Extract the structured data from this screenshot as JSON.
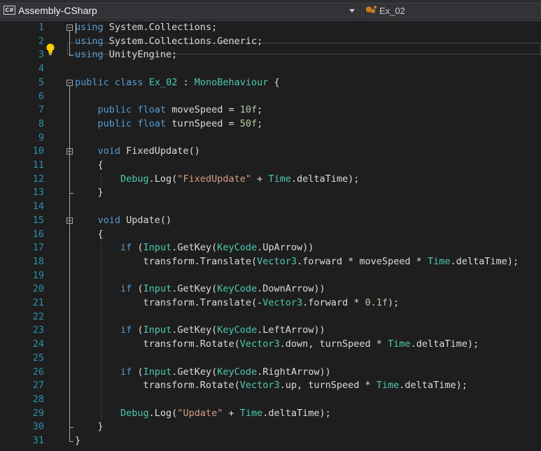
{
  "navbar": {
    "project": "Assembly-CSharp",
    "project_icon": "C#",
    "class_name": "Ex_02"
  },
  "colors": {
    "background": "#1e1e1e",
    "keyword": "#569cd6",
    "type": "#4ec9b0",
    "string": "#d69d85",
    "number": "#b5cea8",
    "line_number": "#2b91af",
    "text": "#dcdcdc"
  },
  "editor": {
    "lines": [
      {
        "num": "1",
        "tokens": [
          [
            "kw",
            "using"
          ],
          [
            "p",
            " System.Collections;"
          ]
        ]
      },
      {
        "num": "2",
        "tokens": [
          [
            "kw",
            "using"
          ],
          [
            "p",
            " System.Collections.Generic;"
          ]
        ]
      },
      {
        "num": "3",
        "tokens": [
          [
            "kw",
            "using"
          ],
          [
            "p",
            " UnityEngine;"
          ]
        ]
      },
      {
        "num": "4",
        "tokens": []
      },
      {
        "num": "5",
        "tokens": [
          [
            "kw",
            "public"
          ],
          [
            "p",
            " "
          ],
          [
            "kw",
            "class"
          ],
          [
            "p",
            " "
          ],
          [
            "ty",
            "Ex_02"
          ],
          [
            "p",
            " : "
          ],
          [
            "ty",
            "MonoBehaviour"
          ],
          [
            "p",
            " {"
          ]
        ]
      },
      {
        "num": "6",
        "tokens": []
      },
      {
        "num": "7",
        "tokens": [
          [
            "p",
            "    "
          ],
          [
            "kw",
            "public"
          ],
          [
            "p",
            " "
          ],
          [
            "kw",
            "float"
          ],
          [
            "p",
            " moveSpeed = "
          ],
          [
            "nm",
            "10f"
          ],
          [
            "p",
            ";"
          ]
        ]
      },
      {
        "num": "8",
        "tokens": [
          [
            "p",
            "    "
          ],
          [
            "kw",
            "public"
          ],
          [
            "p",
            " "
          ],
          [
            "kw",
            "float"
          ],
          [
            "p",
            " turnSpeed = "
          ],
          [
            "nm",
            "50f"
          ],
          [
            "p",
            ";"
          ]
        ]
      },
      {
        "num": "9",
        "tokens": []
      },
      {
        "num": "10",
        "tokens": [
          [
            "p",
            "    "
          ],
          [
            "kw",
            "void"
          ],
          [
            "p",
            " FixedUpdate()"
          ]
        ]
      },
      {
        "num": "11",
        "tokens": [
          [
            "p",
            "    {"
          ]
        ]
      },
      {
        "num": "12",
        "tokens": [
          [
            "p",
            "        "
          ],
          [
            "ty",
            "Debug"
          ],
          [
            "p",
            ".Log("
          ],
          [
            "st",
            "\"FixedUpdate\""
          ],
          [
            "p",
            " + "
          ],
          [
            "ty",
            "Time"
          ],
          [
            "p",
            ".deltaTime);"
          ]
        ]
      },
      {
        "num": "13",
        "tokens": [
          [
            "p",
            "    }"
          ]
        ]
      },
      {
        "num": "14",
        "tokens": []
      },
      {
        "num": "15",
        "tokens": [
          [
            "p",
            "    "
          ],
          [
            "kw",
            "void"
          ],
          [
            "p",
            " Update()"
          ]
        ]
      },
      {
        "num": "16",
        "tokens": [
          [
            "p",
            "    {"
          ]
        ]
      },
      {
        "num": "17",
        "tokens": [
          [
            "p",
            "        "
          ],
          [
            "kw",
            "if"
          ],
          [
            "p",
            " ("
          ],
          [
            "ty",
            "Input"
          ],
          [
            "p",
            ".GetKey("
          ],
          [
            "ty",
            "KeyCode"
          ],
          [
            "p",
            ".UpArrow))"
          ]
        ]
      },
      {
        "num": "18",
        "tokens": [
          [
            "p",
            "            transform.Translate("
          ],
          [
            "ty",
            "Vector3"
          ],
          [
            "p",
            ".forward * moveSpeed * "
          ],
          [
            "ty",
            "Time"
          ],
          [
            "p",
            ".deltaTime);"
          ]
        ]
      },
      {
        "num": "19",
        "tokens": []
      },
      {
        "num": "20",
        "tokens": [
          [
            "p",
            "        "
          ],
          [
            "kw",
            "if"
          ],
          [
            "p",
            " ("
          ],
          [
            "ty",
            "Input"
          ],
          [
            "p",
            ".GetKey("
          ],
          [
            "ty",
            "KeyCode"
          ],
          [
            "p",
            ".DownArrow))"
          ]
        ]
      },
      {
        "num": "21",
        "tokens": [
          [
            "p",
            "            transform.Translate(-"
          ],
          [
            "ty",
            "Vector3"
          ],
          [
            "p",
            ".forward * "
          ],
          [
            "nm",
            "0.1f"
          ],
          [
            "p",
            ");"
          ]
        ]
      },
      {
        "num": "22",
        "tokens": []
      },
      {
        "num": "23",
        "tokens": [
          [
            "p",
            "        "
          ],
          [
            "kw",
            "if"
          ],
          [
            "p",
            " ("
          ],
          [
            "ty",
            "Input"
          ],
          [
            "p",
            ".GetKey("
          ],
          [
            "ty",
            "KeyCode"
          ],
          [
            "p",
            ".LeftArrow))"
          ]
        ]
      },
      {
        "num": "24",
        "tokens": [
          [
            "p",
            "            transform.Rotate("
          ],
          [
            "ty",
            "Vector3"
          ],
          [
            "p",
            ".down, turnSpeed * "
          ],
          [
            "ty",
            "Time"
          ],
          [
            "p",
            ".deltaTime);"
          ]
        ]
      },
      {
        "num": "25",
        "tokens": []
      },
      {
        "num": "26",
        "tokens": [
          [
            "p",
            "        "
          ],
          [
            "kw",
            "if"
          ],
          [
            "p",
            " ("
          ],
          [
            "ty",
            "Input"
          ],
          [
            "p",
            ".GetKey("
          ],
          [
            "ty",
            "KeyCode"
          ],
          [
            "p",
            ".RightArrow))"
          ]
        ]
      },
      {
        "num": "27",
        "tokens": [
          [
            "p",
            "            transform.Rotate("
          ],
          [
            "ty",
            "Vector3"
          ],
          [
            "p",
            ".up, turnSpeed * "
          ],
          [
            "ty",
            "Time"
          ],
          [
            "p",
            ".deltaTime);"
          ]
        ]
      },
      {
        "num": "28",
        "tokens": []
      },
      {
        "num": "29",
        "tokens": [
          [
            "p",
            "        "
          ],
          [
            "ty",
            "Debug"
          ],
          [
            "p",
            ".Log("
          ],
          [
            "st",
            "\"Update\""
          ],
          [
            "p",
            " + "
          ],
          [
            "ty",
            "Time"
          ],
          [
            "p",
            ".deltaTime);"
          ]
        ]
      },
      {
        "num": "30",
        "tokens": [
          [
            "p",
            "    }"
          ]
        ]
      },
      {
        "num": "31",
        "tokens": [
          [
            "p",
            "}"
          ]
        ]
      }
    ]
  }
}
